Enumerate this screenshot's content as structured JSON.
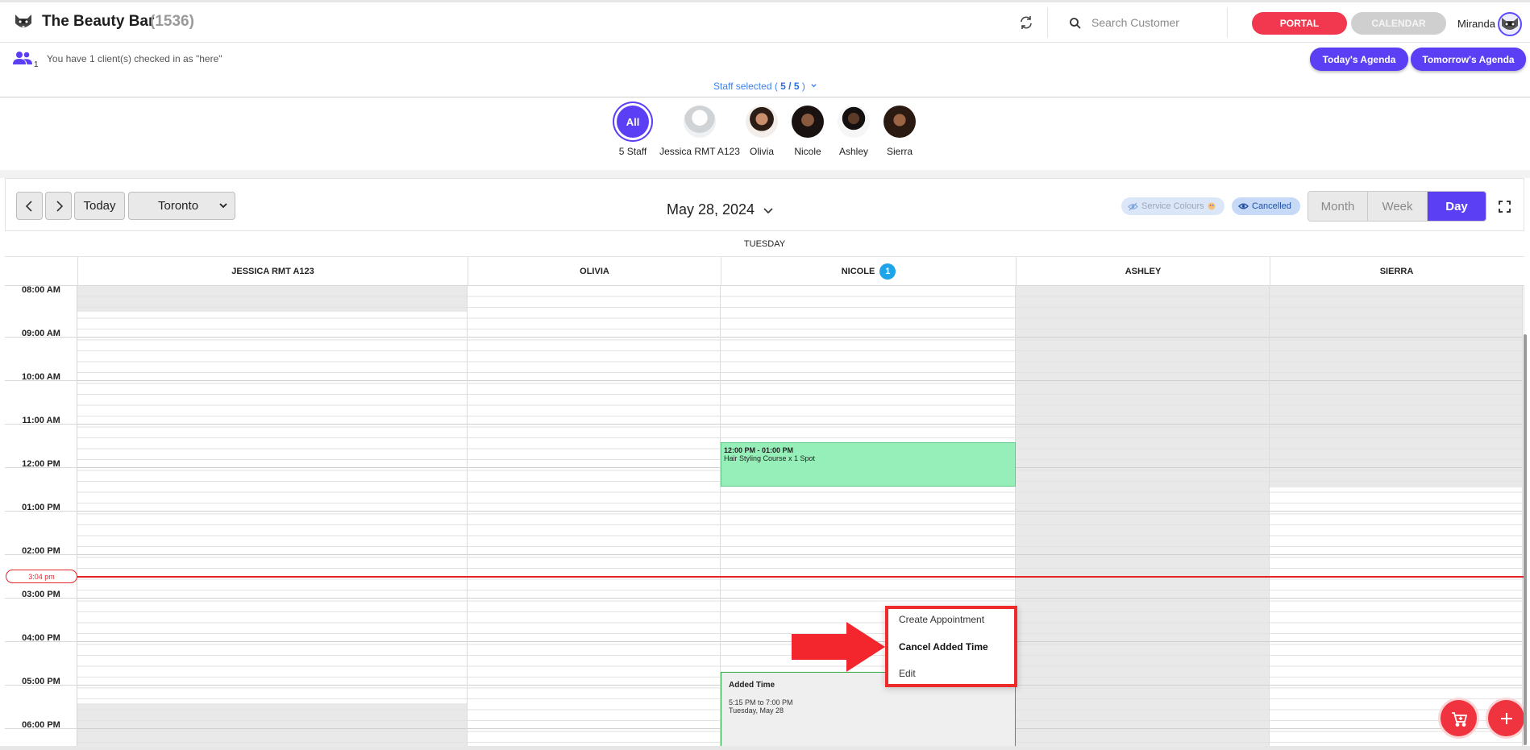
{
  "header": {
    "brand_name": "The Beauty Bar",
    "brand_count": "(1536)",
    "search_placeholder": "Search Customer",
    "portal_label": "PORTAL",
    "calendar_label": "CALENDAR",
    "user_name": "Miranda",
    "colors": {
      "portal": "#f1384f",
      "accent": "#5b3ff5"
    }
  },
  "checkin": {
    "count": "1",
    "text": "You have 1 client(s) checked in as \"here\"",
    "today_agenda": "Today's Agenda",
    "tomorrow_agenda": "Tomorrow's Agenda"
  },
  "staff_selected": {
    "prefix": "Staff selected (",
    "value": "5 / 5",
    "suffix": ")"
  },
  "staff": [
    {
      "label": "5 Staff",
      "avatar_text": "All"
    },
    {
      "label": "Jessica RMT A123"
    },
    {
      "label": "Olivia"
    },
    {
      "label": "Nicole"
    },
    {
      "label": "Ashley"
    },
    {
      "label": "Sierra"
    }
  ],
  "toolbar": {
    "today": "Today",
    "timezone": "Toronto",
    "date": "May 28, 2024",
    "service_colours": "Service Colours",
    "cancelled": "Cancelled",
    "views": [
      "Month",
      "Week",
      "Day"
    ],
    "active_view": "Day"
  },
  "day_label": "TUESDAY",
  "resources": [
    {
      "name": "JESSICA RMT A123"
    },
    {
      "name": "OLIVIA"
    },
    {
      "name": "NICOLE",
      "badge": "1"
    },
    {
      "name": "ASHLEY"
    },
    {
      "name": "SIERRA"
    }
  ],
  "times": [
    "08:00 AM",
    "09:00 AM",
    "10:00 AM",
    "11:00 AM",
    "12:00 PM",
    "01:00 PM",
    "02:00 PM",
    "03:00 PM",
    "04:00 PM",
    "05:00 PM",
    "06:00 PM"
  ],
  "now_indicator": "3:04 pm",
  "events": {
    "course": {
      "time": "12:00 PM - 01:00 PM",
      "title": "Hair Styling Course x 1 Spot"
    },
    "added_time": {
      "title": "Added Time",
      "range": "5:15 PM to 7:00 PM",
      "day": "Tuesday, May 28"
    }
  },
  "context_menu": {
    "items": [
      "Create Appointment",
      "Cancel Added Time",
      "Edit"
    ]
  },
  "icons": [
    "raccoon-logo-icon",
    "sync-icon",
    "search-icon",
    "users-icon",
    "chevron-down-icon",
    "chevron-left-icon",
    "chevron-right-icon",
    "eye-off-icon",
    "eye-icon",
    "fullscreen-icon",
    "cart-plus-icon",
    "plus-icon",
    "arrow-icon"
  ]
}
